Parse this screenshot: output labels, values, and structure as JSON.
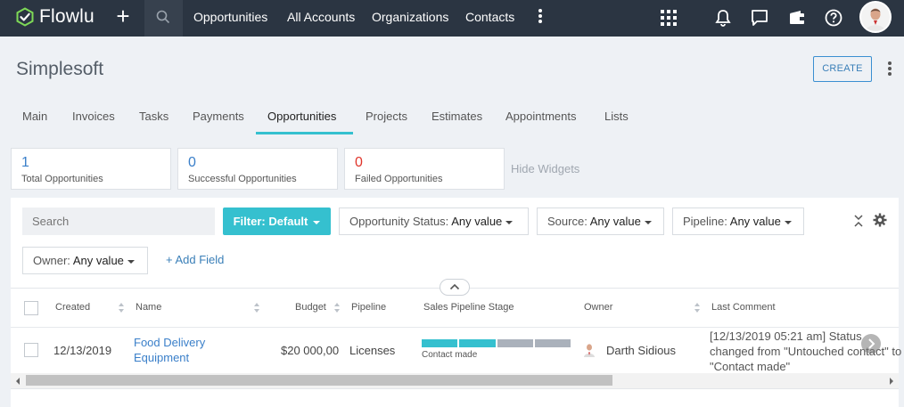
{
  "app": {
    "name": "Flowlu"
  },
  "colors": {
    "navbar": "#2b3542",
    "accent": "#35c0cf",
    "link": "#3a7fc9",
    "failed": "#e0352b"
  },
  "topnav": {
    "links": [
      "Opportunities",
      "All Accounts",
      "Organizations",
      "Contacts"
    ],
    "icons": [
      "plus-icon",
      "search-icon",
      "more-vertical-icon",
      "apps-grid-icon",
      "bell-icon",
      "chat-icon",
      "wallet-icon",
      "help-icon"
    ]
  },
  "header": {
    "title": "Simplesoft",
    "create_label": "CREATE"
  },
  "tabs": [
    "Main",
    "Invoices",
    "Tasks",
    "Payments",
    "Opportunities",
    "Projects",
    "Estimates",
    "Appointments",
    "Lists"
  ],
  "active_tab": "Opportunities",
  "widgets": [
    {
      "value": "1",
      "label": "Total Opportunities"
    },
    {
      "value": "0",
      "label": "Successful Opportunities"
    },
    {
      "value": "0",
      "label": "Failed Opportunities"
    }
  ],
  "hide_widgets_label": "Hide Widgets",
  "filters": {
    "search_placeholder": "Search",
    "filter_label": "Filter: Default",
    "status": {
      "label": "Opportunity Status:",
      "value": "Any value"
    },
    "source": {
      "label": "Source:",
      "value": "Any value"
    },
    "pipeline": {
      "label": "Pipeline:",
      "value": "Any value"
    },
    "owner": {
      "label": "Owner:",
      "value": "Any value"
    },
    "add_field_label": "+ Add Field"
  },
  "table": {
    "columns": [
      "Created",
      "Name",
      "Budget",
      "Pipeline",
      "Sales Pipeline Stage",
      "Owner",
      "Last Comment"
    ],
    "rows": [
      {
        "created": "12/13/2019",
        "name": "Food Delivery Equipment",
        "budget": "$20 000,00",
        "pipeline": "Licenses",
        "stage": "Contact made",
        "stage_progress": {
          "completed": 2,
          "total": 4
        },
        "owner": "Darth Sidious",
        "last_comment": "[12/13/2019 05:21 am] Status changed from \"Untouched contact\" to \"Contact made\""
      }
    ]
  }
}
